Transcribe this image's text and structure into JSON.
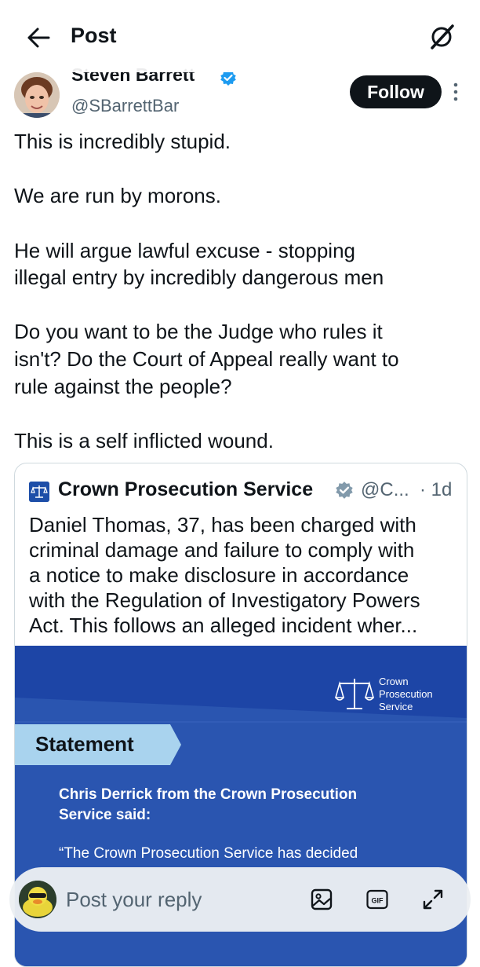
{
  "header": {
    "title": "Post",
    "back_icon": "arrow-left-icon",
    "grok_icon": "grok-icon"
  },
  "author": {
    "name": "Steven Barrett",
    "handle": "@SBarrettBar",
    "verified": true,
    "follow_label": "Follow",
    "more_icon": "more-vertical-icon"
  },
  "tweet": {
    "lines": [
      "This is incredibly stupid.",
      "We are run by morons.",
      "He will argue lawful excuse - stopping",
      "illegal entry by incredibly dangerous men",
      "Do you want to be the Judge who rules it",
      "isn't? Do the Court of Appeal really want to",
      "rule against the people?",
      "This is a self inflicted wound."
    ]
  },
  "quote": {
    "name": "Crown Prosecution Service",
    "handle": "@C...",
    "time": "· 1d",
    "verified_color": "#829aab",
    "lines": [
      "Daniel Thomas, 37, has been charged with",
      "criminal damage and failure to comply with",
      "a notice to make disclosure in accordance",
      "with the Regulation of Investigatory Powers",
      "Act. This follows an alleged incident wher..."
    ],
    "media": {
      "logo_lines": [
        "Crown",
        "Prosecution",
        "Service"
      ],
      "tag": "Statement",
      "speaker_lines": [
        "Chris Derrick from the Crown Prosecution",
        "Service said:"
      ],
      "quote_line": "“The Crown Prosecution Service has decided"
    }
  },
  "reply": {
    "placeholder": "Post your reply",
    "gif_label": "GIF"
  },
  "colors": {
    "brand_blue": "#1d4ea8",
    "media_blue": "#2a55b0",
    "tag_blue": "#a9d3ee",
    "verified_blue": "#1d9bf0"
  }
}
